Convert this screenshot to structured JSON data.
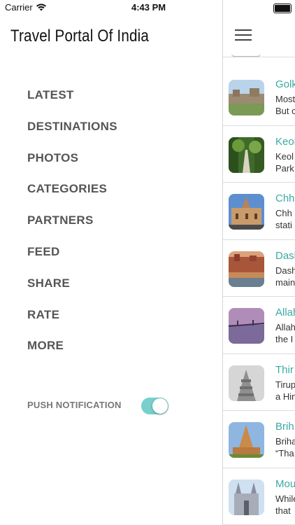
{
  "status_bar": {
    "carrier": "Carrier",
    "time": "4:43 PM"
  },
  "drawer": {
    "title": "Travel Portal Of India",
    "menu": [
      {
        "label": "LATEST"
      },
      {
        "label": "DESTINATIONS"
      },
      {
        "label": "PHOTOS"
      },
      {
        "label": "CATEGORIES"
      },
      {
        "label": "PARTNERS"
      },
      {
        "label": "FEED"
      },
      {
        "label": "SHARE"
      },
      {
        "label": "RATE"
      },
      {
        "label": "MORE"
      }
    ],
    "push_notification": {
      "label": "PUSH NOTIFICATION",
      "enabled": true
    }
  },
  "colors": {
    "accent": "#3aa9a3",
    "toggle_on": "#78cfcc",
    "menu_text": "#555555"
  },
  "list": [
    {
      "title": "Golk",
      "desc1": "Most",
      "desc2": "But c",
      "thumb": "fort-photo"
    },
    {
      "title": "Keol",
      "desc1": "Keol",
      "desc2": "Park",
      "thumb": "forest-path-photo"
    },
    {
      "title": "Chh",
      "desc1": "Chh",
      "desc2": "stati",
      "thumb": "railway-station-photo"
    },
    {
      "title": "Dash",
      "desc1": "Dash",
      "desc2": "main",
      "thumb": "ghats-photo"
    },
    {
      "title": "Allah",
      "desc1": "Allah",
      "desc2": "the I",
      "thumb": "river-bridge-photo"
    },
    {
      "title": "Thir",
      "desc1": "Tirup",
      "desc2": "a Hin",
      "thumb": "temple-tower-photo"
    },
    {
      "title": "Brih",
      "desc1": "Briha",
      "desc2": "“Tha",
      "thumb": "temple-photo"
    },
    {
      "title": "Mou",
      "desc1": "While",
      "desc2": "that",
      "thumb": "church-photo"
    }
  ]
}
